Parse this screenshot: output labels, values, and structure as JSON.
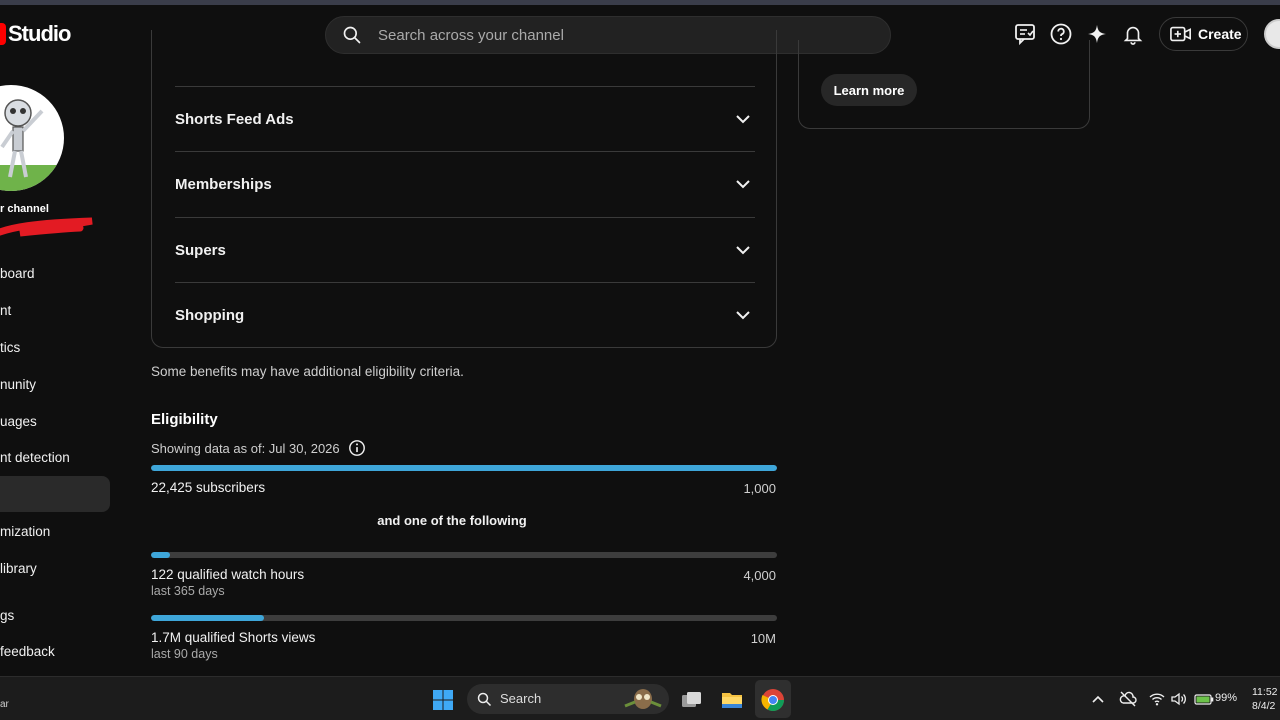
{
  "header": {
    "app_title": "Studio",
    "search_placeholder": "Search across your channel",
    "create_label": "Create",
    "icons": [
      "feedback-icon",
      "help-icon",
      "sparkle-icon",
      "bell-icon",
      "create-video-icon"
    ]
  },
  "sidebar": {
    "channel_label": "r channel",
    "items": [
      {
        "label": "board"
      },
      {
        "label": "nt"
      },
      {
        "label": "tics"
      },
      {
        "label": "nunity"
      },
      {
        "label": "uages"
      },
      {
        "label": "nt detection"
      },
      {
        "label": ""
      },
      {
        "label": "mization"
      },
      {
        "label": "library"
      },
      {
        "label": "gs"
      },
      {
        "label": "feedback"
      }
    ]
  },
  "benefits": {
    "rows": [
      {
        "label": "Shorts Feed Ads"
      },
      {
        "label": "Memberships"
      },
      {
        "label": "Supers"
      },
      {
        "label": "Shopping"
      }
    ],
    "note": "Some benefits may have additional eligibility criteria."
  },
  "eligibility": {
    "title": "Eligibility",
    "as_of": "Showing data as of: Jul 30, 2026",
    "subscribers": {
      "label": "22,425 subscribers",
      "target": "1,000",
      "progress": 1.0
    },
    "or_text": "and one of the following",
    "watch_hours": {
      "label": "122 qualified watch hours",
      "sub": "last 365 days",
      "target": "4,000",
      "progress": 0.03
    },
    "shorts_views": {
      "label": "1.7M qualified Shorts views",
      "sub": "last 90 days",
      "target": "10M",
      "progress": 0.18
    }
  },
  "side_card": {
    "learn_more_label": "Learn more"
  },
  "taskbar": {
    "left_text": "ar",
    "search_label": "Search",
    "battery": "99%",
    "time": "11:52",
    "date": "8/4/2"
  },
  "colors": {
    "accent": "#3ea6d9",
    "brand": "#ff0000",
    "background": "#0f0f0f"
  }
}
